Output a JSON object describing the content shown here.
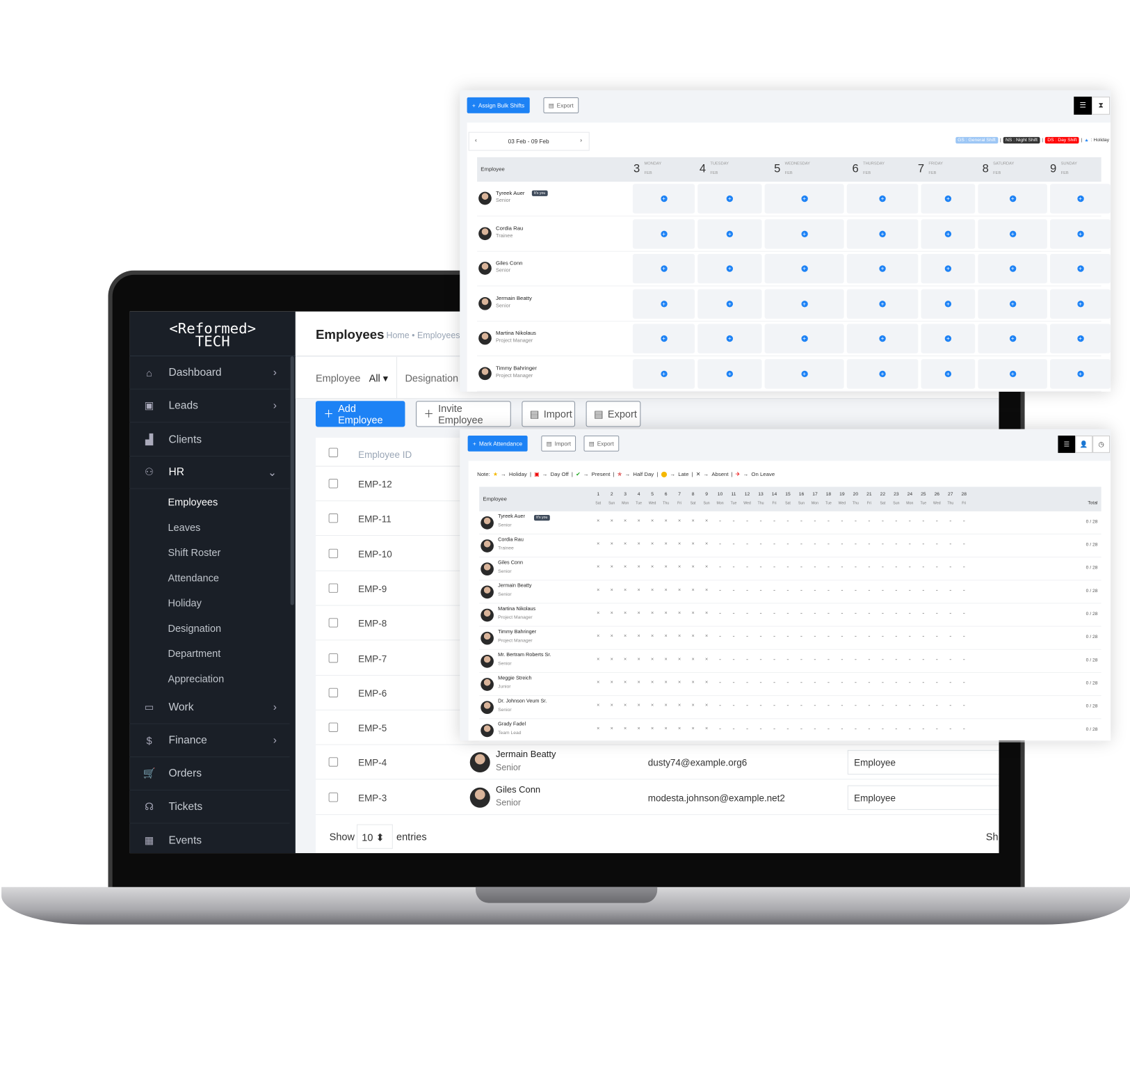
{
  "colors": {
    "primary": "#1d82f5",
    "sidebar": "#1a1f27"
  },
  "logo": "<Reformed> TECH",
  "sidebar": {
    "items": [
      {
        "label": "Dashboard",
        "icon": "home-icon",
        "chevron": true
      },
      {
        "label": "Leads",
        "icon": "lead-card-icon",
        "chevron": true
      },
      {
        "label": "Clients",
        "icon": "clients-icon",
        "chevron": false
      },
      {
        "label": "HR",
        "icon": "people-icon",
        "chevron": true,
        "expanded": true
      },
      {
        "label": "Work",
        "icon": "briefcase-icon",
        "chevron": true
      },
      {
        "label": "Finance",
        "icon": "dollar-icon",
        "chevron": true
      },
      {
        "label": "Orders",
        "icon": "cart-icon",
        "chevron": false
      },
      {
        "label": "Tickets",
        "icon": "headset-icon",
        "chevron": false
      },
      {
        "label": "Events",
        "icon": "calendar-icon",
        "chevron": false
      }
    ],
    "hr_sub": [
      "Employees",
      "Leaves",
      "Shift Roster",
      "Attendance",
      "Holiday",
      "Designation",
      "Department",
      "Appreciation"
    ]
  },
  "employees": {
    "title": "Employees",
    "breadcrumb": "Home • Employees",
    "filter_label": "Employee",
    "filter_value": "All",
    "filter2_label": "Designation",
    "buttons": {
      "add": "Add Employee",
      "invite": "Invite Employee",
      "import": "Import",
      "export": "Export"
    },
    "col_id": "Employee ID",
    "rows": [
      {
        "id": "EMP-12"
      },
      {
        "id": "EMP-11"
      },
      {
        "id": "EMP-10"
      },
      {
        "id": "EMP-9"
      },
      {
        "id": "EMP-8"
      },
      {
        "id": "EMP-7"
      },
      {
        "id": "EMP-6"
      },
      {
        "id": "EMP-5"
      },
      {
        "id": "EMP-4",
        "name": "Jermain Beatty",
        "designation": "Senior",
        "email": "dusty74@example.org6",
        "role": "Employee"
      },
      {
        "id": "EMP-3",
        "name": "Giles Conn",
        "designation": "Senior",
        "email": "modesta.johnson@example.net2",
        "role": "Employee"
      }
    ],
    "show": "Show",
    "show_value": "10",
    "entries": "entries",
    "footer_right": "Sh"
  },
  "shift": {
    "assign": "Assign Bulk Shifts",
    "export": "Export",
    "range": "03 Feb - 09 Feb",
    "legend": {
      "gs": "GS : General Shift",
      "ns": "NS : Night Shift",
      "ds": "DS : Day Shift",
      "holiday": ": Holiday"
    },
    "col_employee": "Employee",
    "days": [
      {
        "d": "3",
        "w": "MONDAY",
        "m": "FEB"
      },
      {
        "d": "4",
        "w": "TUESDAY",
        "m": "FEB"
      },
      {
        "d": "5",
        "w": "WEDNESDAY",
        "m": "FEB"
      },
      {
        "d": "6",
        "w": "THURSDAY",
        "m": "FEB"
      },
      {
        "d": "7",
        "w": "FRIDAY",
        "m": "FEB"
      },
      {
        "d": "8",
        "w": "SATURDAY",
        "m": "FEB"
      },
      {
        "d": "9",
        "w": "SUNDAY",
        "m": "FEB"
      }
    ],
    "rows": [
      {
        "name": "Tyreek Auer",
        "desig": "Senior",
        "badge": "It's you"
      },
      {
        "name": "Cordia Rau",
        "desig": "Trainee"
      },
      {
        "name": "Giles Conn",
        "desig": "Senior"
      },
      {
        "name": "Jermain Beatty",
        "desig": "Senior"
      },
      {
        "name": "Martina Nikolaus",
        "desig": "Project Manager"
      },
      {
        "name": "Timmy Bahringer",
        "desig": "Project Manager"
      }
    ]
  },
  "attendance": {
    "mark": "Mark Attendance",
    "import": "Import",
    "export": "Export",
    "note": "Note:",
    "legend": [
      "Holiday",
      "Day Off",
      "Present",
      "Half Day",
      "Late",
      "Absent",
      "On Leave"
    ],
    "col_employee": "Employee",
    "col_total": "Total",
    "days": [
      "1",
      "2",
      "3",
      "4",
      "5",
      "6",
      "7",
      "8",
      "9",
      "10",
      "11",
      "12",
      "13",
      "14",
      "15",
      "16",
      "17",
      "18",
      "19",
      "20",
      "21",
      "22",
      "23",
      "24",
      "25",
      "26",
      "27",
      "28"
    ],
    "weekdays": [
      "Sat",
      "Sun",
      "Mon",
      "Tue",
      "Wed",
      "Thu",
      "Fri",
      "Sat",
      "Sun",
      "Mon",
      "Tue",
      "Wed",
      "Thu",
      "Fri",
      "Sat",
      "Sun",
      "Mon",
      "Tue",
      "Wed",
      "Thu",
      "Fri",
      "Sat",
      "Sun",
      "Mon",
      "Tue",
      "Wed",
      "Thu",
      "Fri"
    ],
    "absent_days": 9,
    "rows": [
      {
        "name": "Tyreek Auer",
        "desig": "Senior",
        "badge": "It's you",
        "total": "0 / 28"
      },
      {
        "name": "Cordia Rau",
        "desig": "Trainee",
        "total": "0 / 28"
      },
      {
        "name": "Giles Conn",
        "desig": "Senior",
        "total": "0 / 28"
      },
      {
        "name": "Jermain Beatty",
        "desig": "Senior",
        "total": "0 / 28"
      },
      {
        "name": "Martina Nikolaus",
        "desig": "Project Manager",
        "total": "0 / 28"
      },
      {
        "name": "Timmy Bahringer",
        "desig": "Project Manager",
        "total": "0 / 28"
      },
      {
        "name": "Mr. Bertram Roberts Sr.",
        "desig": "Senior",
        "total": "0 / 28"
      },
      {
        "name": "Meggie Streich",
        "desig": "Junior",
        "total": "0 / 28"
      },
      {
        "name": "Dr. Johnson Veum Sr.",
        "desig": "Senior",
        "total": "0 / 28"
      },
      {
        "name": "Grady Fadel",
        "desig": "Team Lead",
        "total": "0 / 28"
      }
    ]
  }
}
